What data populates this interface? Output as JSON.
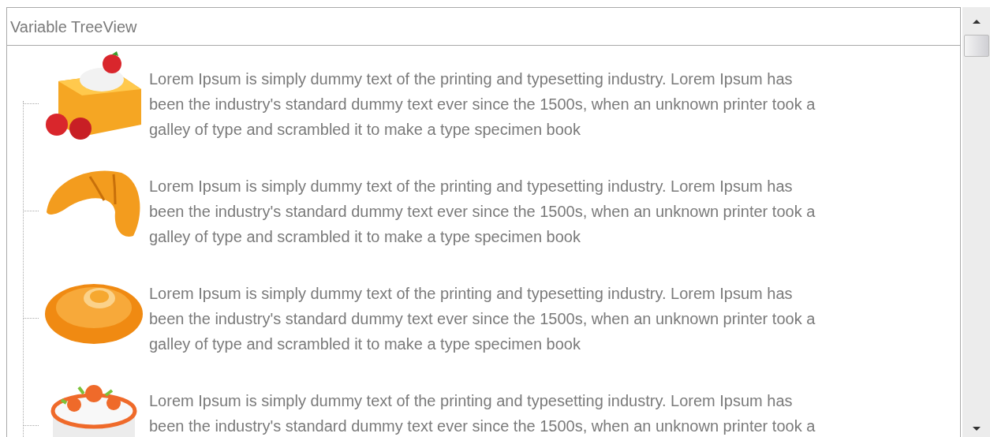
{
  "header": {
    "title": "Variable TreeView"
  },
  "items": [
    {
      "kind": "strawberry-cake",
      "lines": [
        "Lorem Ipsum is simply dummy text of the printing and typesetting industry. Lorem Ipsum has",
        "been the industry's standard dummy text ever since the 1500s, when an unknown printer took a",
        "galley of type and scrambled it to make a type specimen book"
      ]
    },
    {
      "kind": "croissant",
      "lines": [
        "Lorem Ipsum is simply dummy text of the printing and typesetting industry. Lorem Ipsum has",
        "been the industry's standard dummy text ever since the 1500s, when an unknown printer took a",
        "galley of type and scrambled it to make a type specimen book"
      ]
    },
    {
      "kind": "bun",
      "lines": [
        "Lorem Ipsum is simply dummy text of the printing and typesetting industry. Lorem Ipsum has",
        "been the industry's standard dummy text ever since the 1500s, when an unknown printer took a",
        "galley of type and scrambled it to make a type specimen book"
      ]
    },
    {
      "kind": "rose-cake",
      "lines": [
        "Lorem Ipsum is simply dummy text of the printing and typesetting industry. Lorem Ipsum has",
        "been the industry's standard dummy text ever since the 1500s, when an unknown printer took a"
      ]
    }
  ]
}
